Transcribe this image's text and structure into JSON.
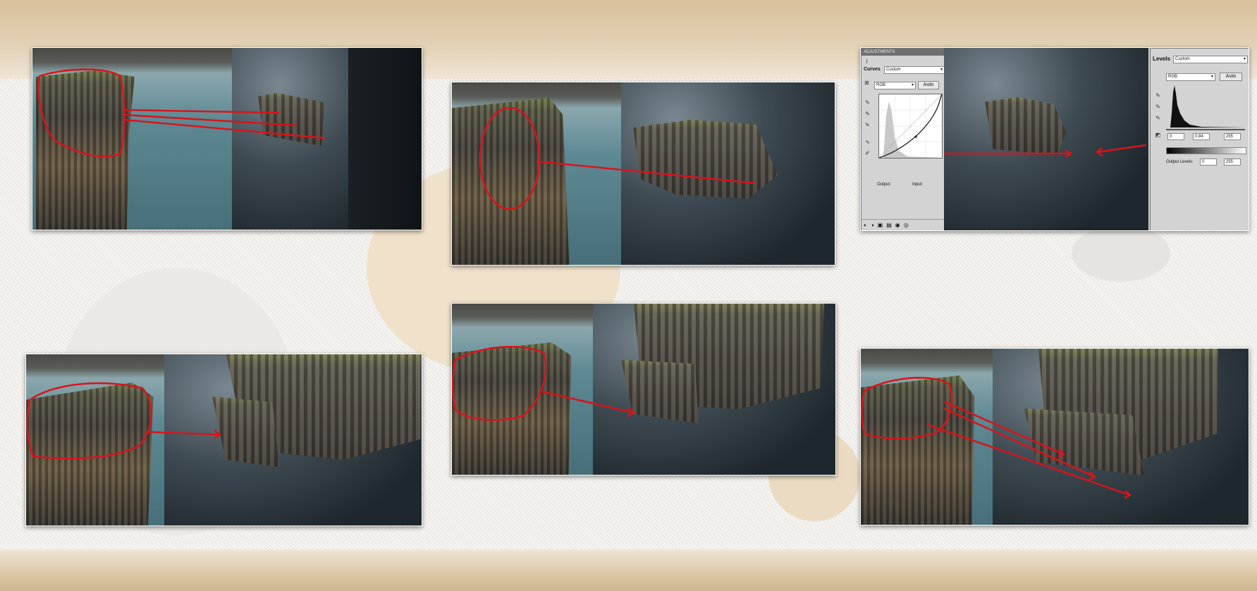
{
  "adjustments_panel": {
    "tab_label": "ADJUSTMENTS",
    "mode_label": "Curves",
    "preset_value": "Custom",
    "channel_value": "RGB",
    "auto_label": "Auto",
    "output_label": "Output:",
    "input_label": "Input:"
  },
  "levels_panel": {
    "mode_label": "Levels",
    "preset_value": "Custom",
    "channel_value": "RGB",
    "auto_label": "Auto",
    "input_black": "0",
    "input_gamma": "0.84",
    "input_white": "255",
    "output_levels_label": "Output Levels:",
    "output_black": "0",
    "output_white": "255"
  },
  "colors": {
    "annotation_red": "#d8141b",
    "band_tan": "#d8c19c"
  },
  "icons": [
    "curves-icon",
    "eyedropper-icon",
    "chevron-down-icon",
    "histogram-icon"
  ]
}
